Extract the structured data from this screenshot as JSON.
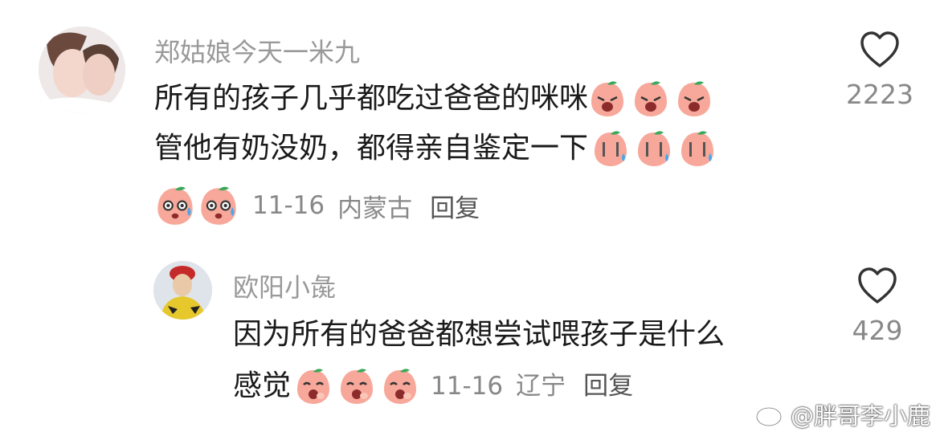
{
  "comments": [
    {
      "username": "郑姑娘今天一米九",
      "lines": [
        "所有的孩子几乎都吃过爸爸的咪咪",
        "管他有奶没奶，都得亲自鉴定一下"
      ],
      "emojis_line1": [
        "cry-peach-emoji",
        "cry-peach-emoji",
        "cry-peach-emoji"
      ],
      "emojis_line2": [
        "sweat-peach-emoji",
        "sweat-peach-emoji",
        "sweat-peach-emoji"
      ],
      "emojis_meta": [
        "wow-sweat-peach-emoji",
        "wow-sweat-peach-emoji"
      ],
      "date": "11-16",
      "location": "内蒙古",
      "reply_label": "回复",
      "likes": "2223"
    },
    {
      "username": "欧阳小彘",
      "lines": [
        "因为所有的爸爸都想尝试喂孩子是什么",
        "感觉"
      ],
      "emojis_line2": [
        "laugh-peach-emoji",
        "laugh-peach-emoji",
        "laugh-peach-emoji"
      ],
      "date": "11-16",
      "location": "辽宁",
      "reply_label": "回复",
      "likes": "429"
    }
  ],
  "watermark": {
    "text": "@胖哥李小鹿",
    "icon": "weibo-icon"
  },
  "colors": {
    "username": "#999999",
    "text": "#1a1a1a",
    "meta": "#888888",
    "peach": "#f7a89a",
    "leaf": "#3aa85a"
  }
}
